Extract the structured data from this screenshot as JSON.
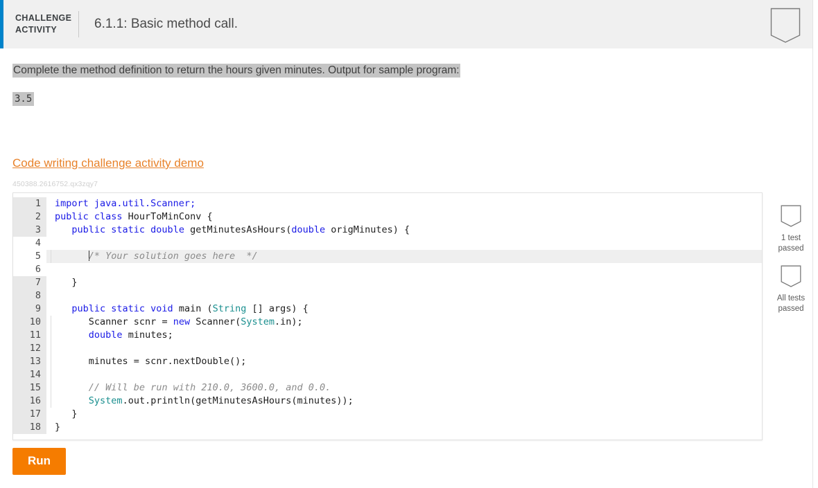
{
  "header": {
    "badge_line1": "CHALLENGE",
    "badge_line2": "ACTIVITY",
    "title": "6.1.1: Basic method call.",
    "bookmark_icon": "shield-bookmark-icon"
  },
  "prompt": {
    "text": "Complete the method definition to return the hours given minutes. Output for sample program:",
    "sample_output": "3.5"
  },
  "demo": {
    "link_text": "Code writing challenge activity demo",
    "activity_id": "450388.2616752.qx3zqy7"
  },
  "editor": {
    "lines": [
      {
        "n": "1",
        "readonly": true
      },
      {
        "n": "2",
        "readonly": true
      },
      {
        "n": "3",
        "readonly": true
      },
      {
        "n": "4",
        "readonly": false
      },
      {
        "n": "5",
        "readonly": false
      },
      {
        "n": "6",
        "readonly": false
      },
      {
        "n": "7",
        "readonly": true
      },
      {
        "n": "8",
        "readonly": true
      },
      {
        "n": "9",
        "readonly": true
      },
      {
        "n": "10",
        "readonly": true
      },
      {
        "n": "11",
        "readonly": true
      },
      {
        "n": "12",
        "readonly": true
      },
      {
        "n": "13",
        "readonly": true
      },
      {
        "n": "14",
        "readonly": true
      },
      {
        "n": "15",
        "readonly": true
      },
      {
        "n": "16",
        "readonly": true
      },
      {
        "n": "17",
        "readonly": true
      },
      {
        "n": "18",
        "readonly": true
      }
    ],
    "code": {
      "l1": "import java.util.Scanner;",
      "l2_kw": "public class",
      "l2_rest": " HourToMinConv {",
      "l3_kw1": "public static double",
      "l3_name": " getMinutesAsHours(",
      "l3_kw2": "double",
      "l3_rest": " origMinutes) {",
      "l4": "",
      "l5_comment": "/* Your solution goes here  */",
      "l6": "",
      "l7": "}",
      "l8": "",
      "l9_kw": "public static void",
      "l9_main": " main (",
      "l9_type": "String",
      "l9_rest": " [] args) {",
      "l10_a": "Scanner scnr ",
      "l10_eq": "= ",
      "l10_new": "new",
      "l10_b": " Scanner(",
      "l10_sys": "System",
      "l10_c": ".in);",
      "l11_kw": "double",
      "l11_rest": " minutes;",
      "l12": "",
      "l13": "minutes = scnr.nextDouble();",
      "l14": "",
      "l15_comment": "// Will be run with 210.0, 3600.0, and 0.0.",
      "l16_sys": "System",
      "l16_rest": ".out.println(getMinutesAsHours(minutes));",
      "l17": "}",
      "l18": "}"
    }
  },
  "run_button": {
    "label": "Run"
  },
  "right_rail": {
    "items": [
      {
        "icon": "shield-badge-icon",
        "label_line1": "1 test",
        "label_line2": "passed"
      },
      {
        "icon": "shield-badge-icon",
        "label_line1": "All tests",
        "label_line2": "passed"
      }
    ]
  },
  "colors": {
    "accent_blue": "#0083ca",
    "run_orange": "#f57c00",
    "link_orange": "#e8822a",
    "header_bg": "#f0f0f0",
    "highlight_gray": "#c4c4c4",
    "gutter_readonly": "#e8e8e8",
    "keyword_blue": "#1a1ae6",
    "type_teal": "#1a8f8f",
    "comment_gray": "#8b8b8b"
  }
}
